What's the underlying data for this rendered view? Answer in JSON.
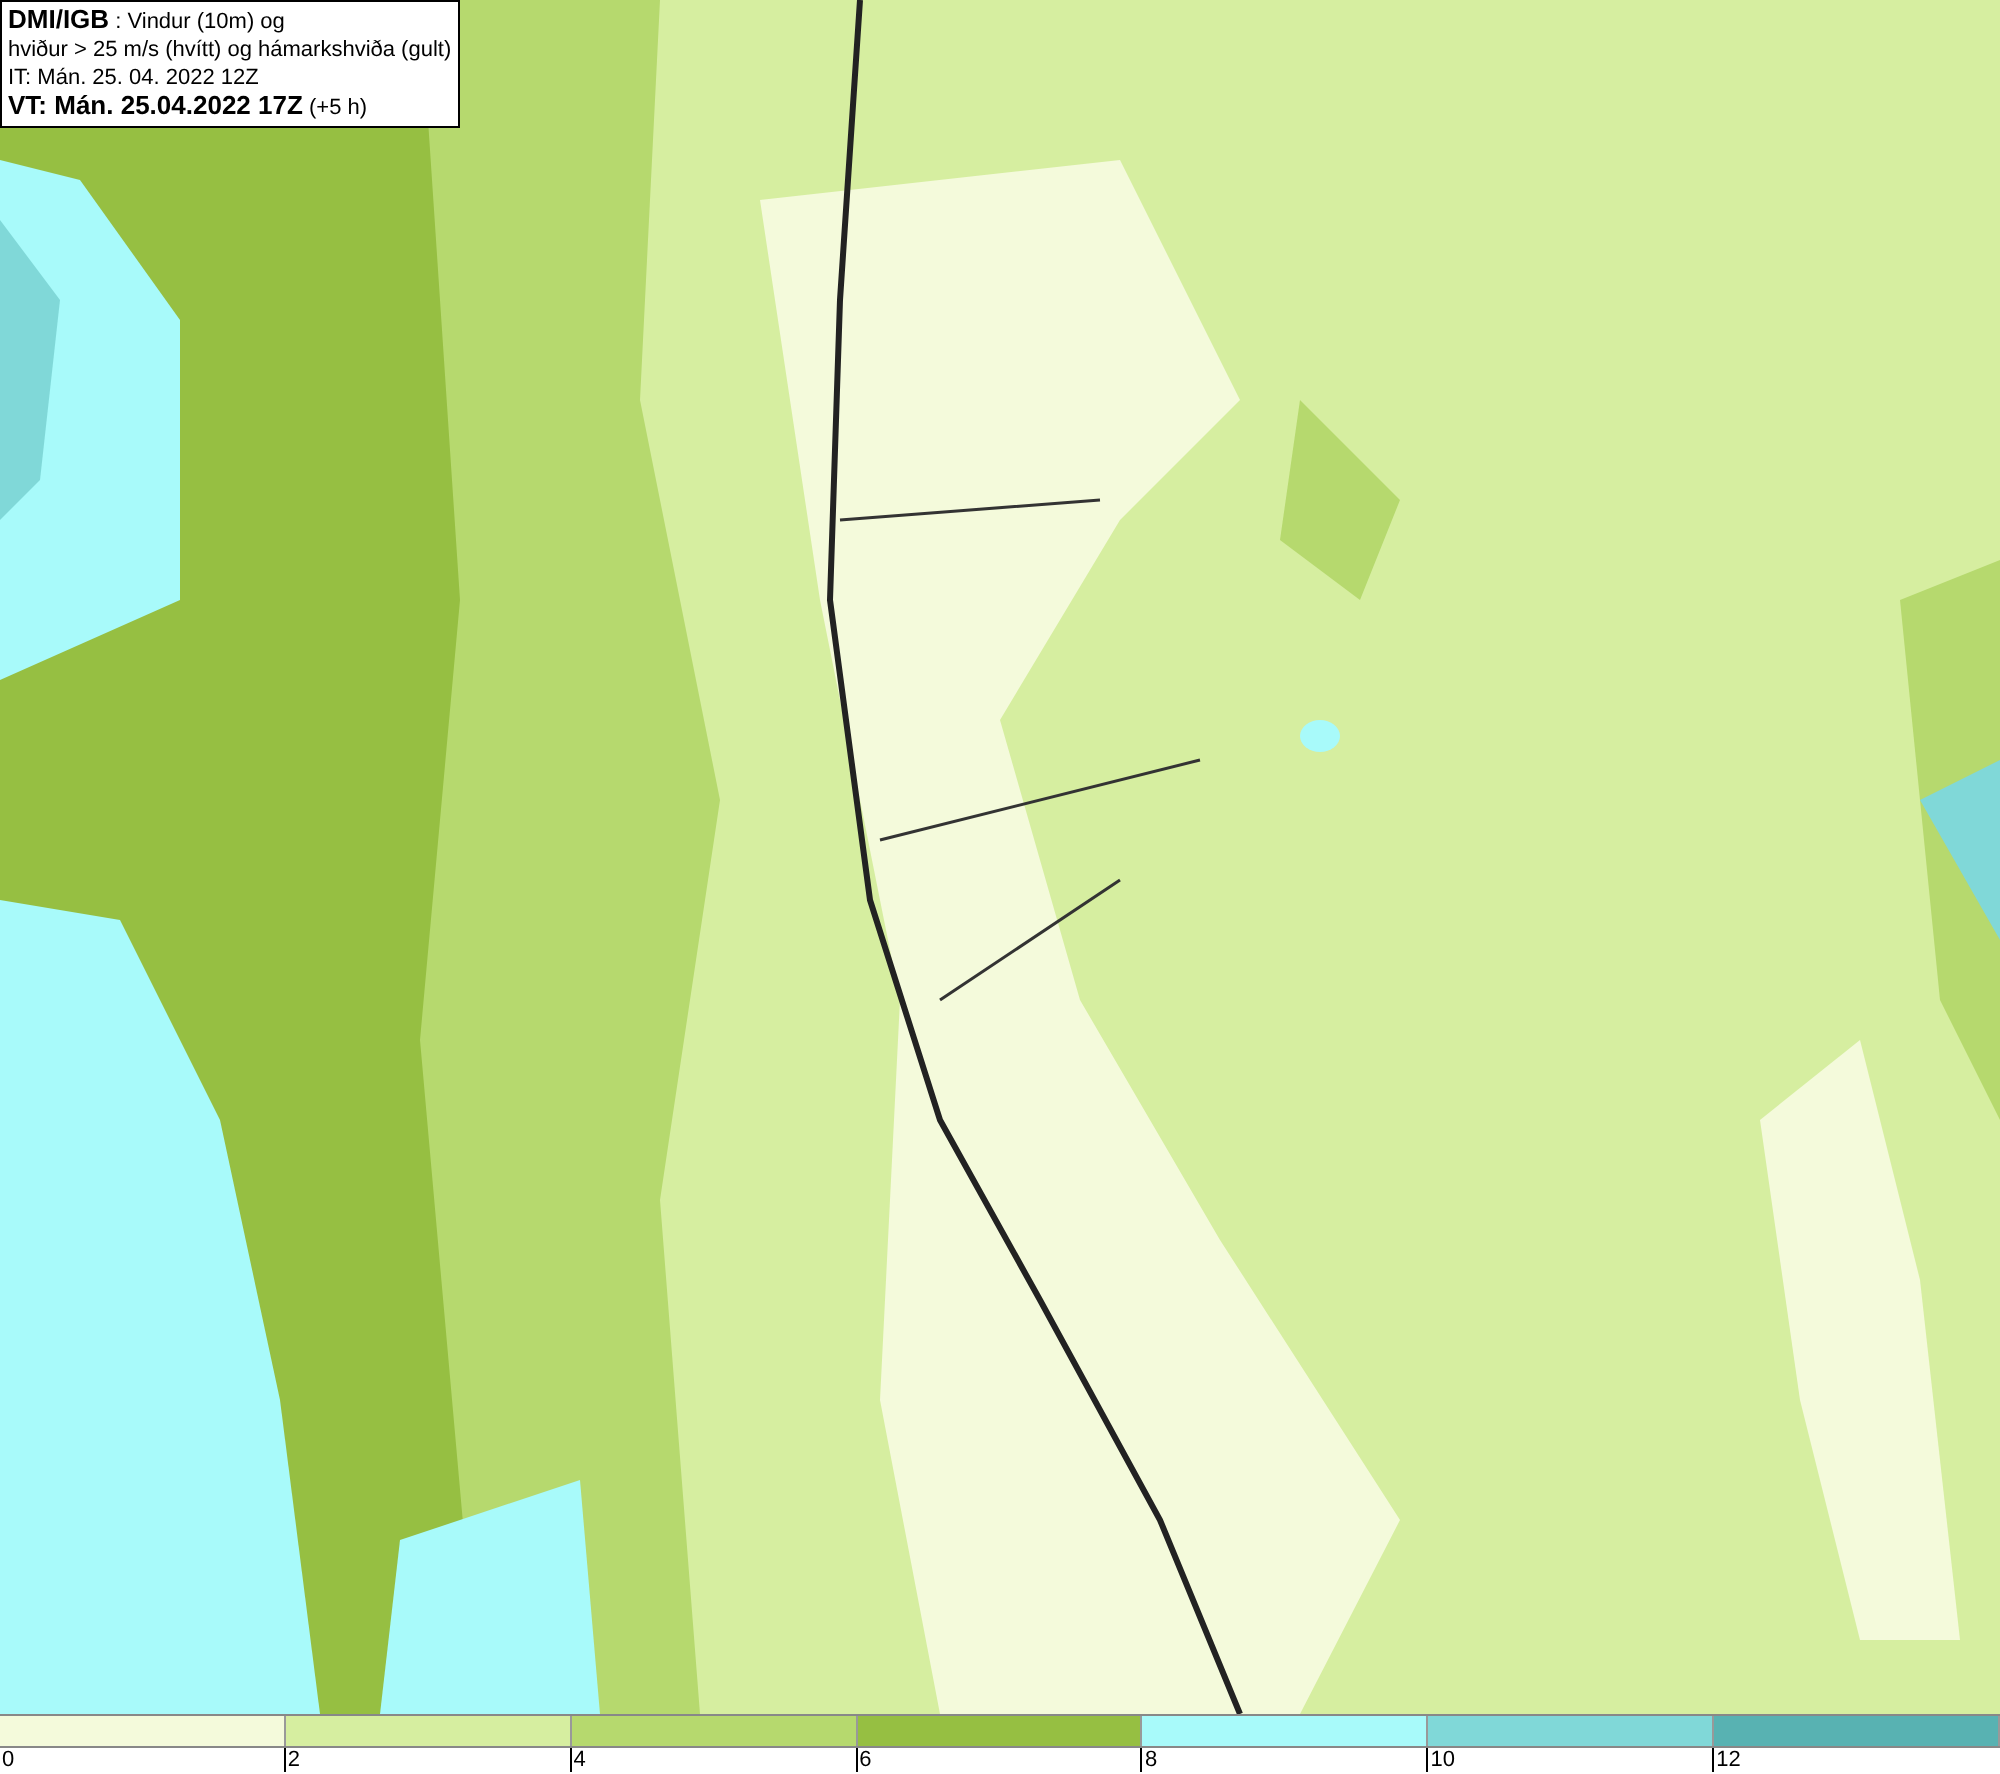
{
  "info_box": {
    "lines": [
      "**DMI/IGB** : Vindur (10m) og",
      "hviður > 25 m/s (hvítt) og hámarkshviða (gult)",
      "IT: Mán. 25. 04. 2022 12Z",
      "**VT: Mán. 25.04.2022 17Z** (+5 h)"
    ]
  },
  "legend": {
    "bins": [
      {
        "color": "#f4fadb"
      },
      {
        "color": "#d6eea0"
      },
      {
        "color": "#b6d96e"
      },
      {
        "color": "#96bf42"
      },
      {
        "color": "#a8fafa"
      },
      {
        "color": "#80d8d8"
      },
      {
        "color": "#58b2b2"
      }
    ],
    "ticks": [
      "0",
      "2",
      "4",
      "6",
      "8",
      "10",
      "12"
    ]
  }
}
